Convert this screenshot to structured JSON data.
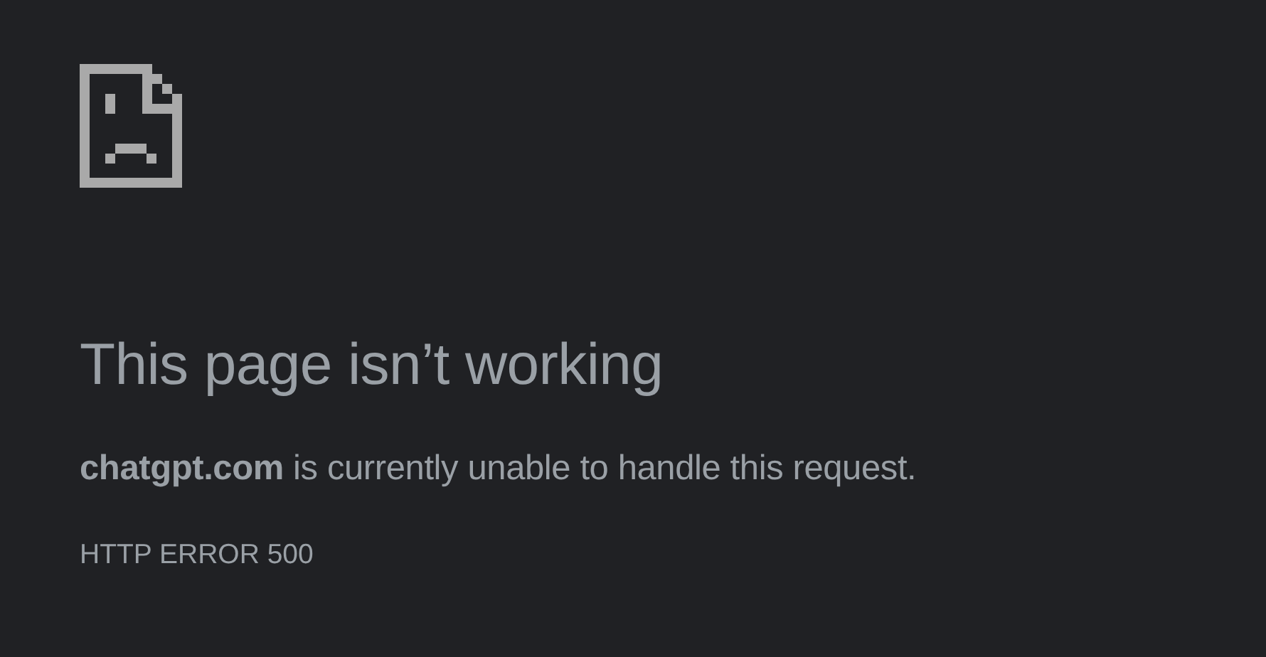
{
  "heading": "This page isn’t working",
  "message": "**chatgpt.com** is currently unable to handle this request.",
  "error_code": "HTTP ERROR 500"
}
